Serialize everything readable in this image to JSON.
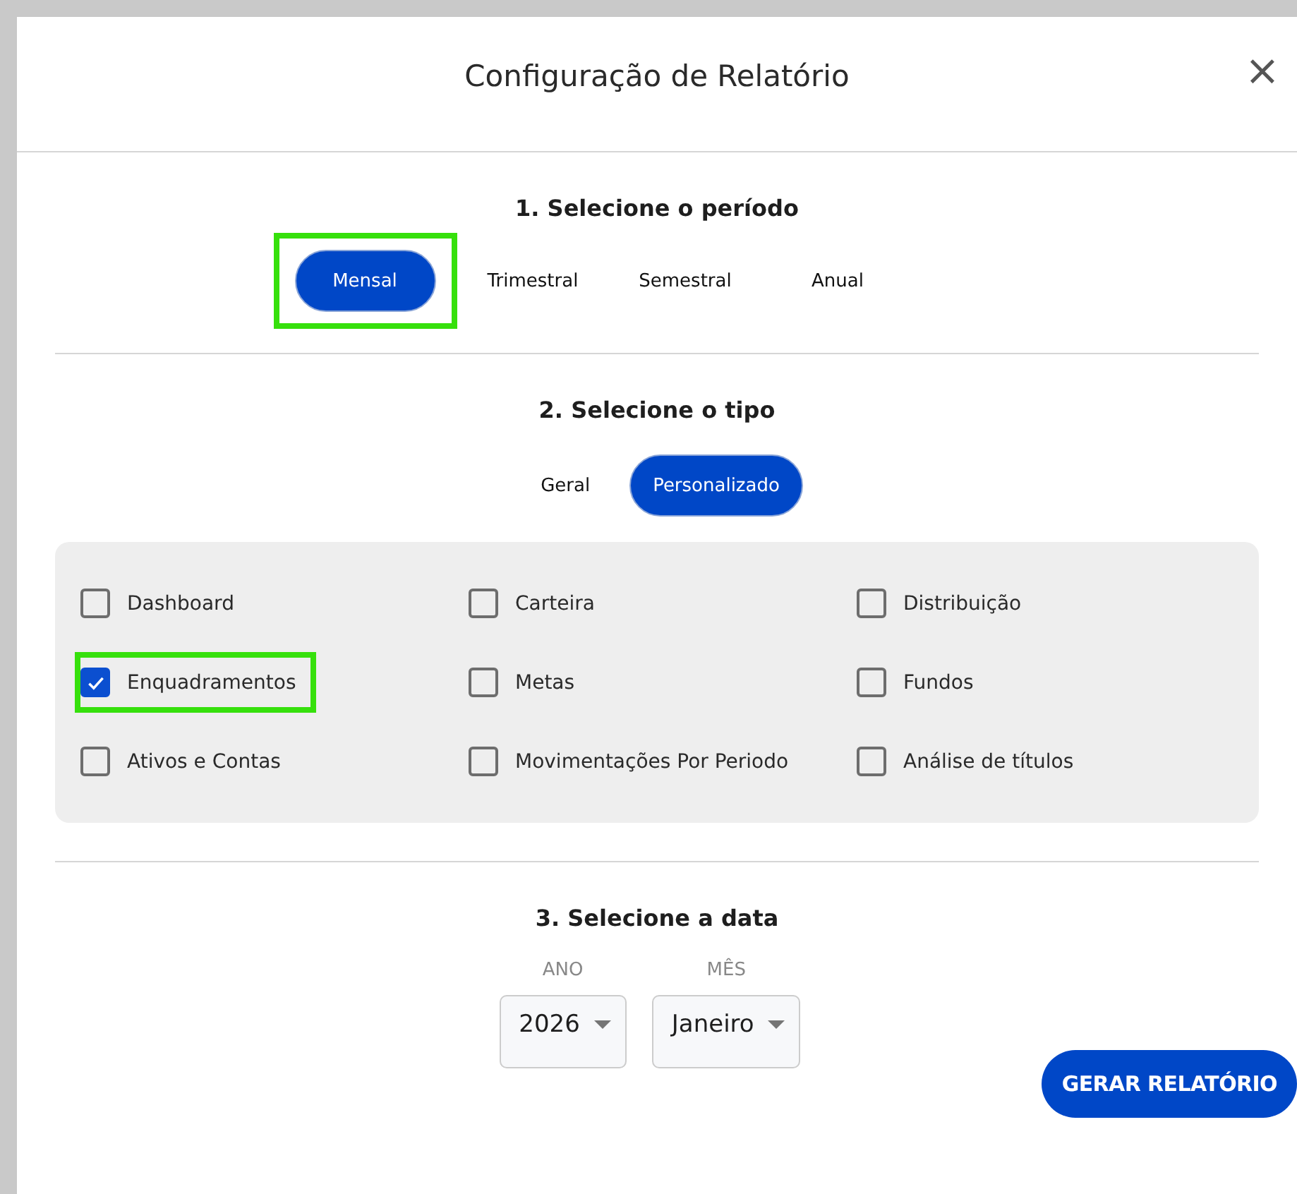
{
  "dialog": {
    "title": "Configuração de Relatório",
    "close": "×"
  },
  "period": {
    "heading": "1. Selecione o período",
    "options": [
      {
        "label": "Mensal",
        "selected": true,
        "highlighted": true
      },
      {
        "label": "Trimestral",
        "selected": false,
        "highlighted": false
      },
      {
        "label": "Semestral",
        "selected": false,
        "highlighted": false
      },
      {
        "label": "Anual",
        "selected": false,
        "highlighted": false
      }
    ]
  },
  "type": {
    "heading": "2. Selecione o tipo",
    "options": [
      {
        "label": "Geral",
        "selected": false
      },
      {
        "label": "Personalizado",
        "selected": true
      }
    ]
  },
  "reports": [
    {
      "label": "Dashboard",
      "checked": false,
      "highlighted": false
    },
    {
      "label": "Carteira",
      "checked": false,
      "highlighted": false
    },
    {
      "label": "Distribuição",
      "checked": false,
      "highlighted": false
    },
    {
      "label": "Enquadramentos",
      "checked": true,
      "highlighted": true
    },
    {
      "label": "Metas",
      "checked": false,
      "highlighted": false
    },
    {
      "label": "Fundos",
      "checked": false,
      "highlighted": false
    },
    {
      "label": "Ativos e Contas",
      "checked": false,
      "highlighted": false
    },
    {
      "label": "Movimentações Por Periodo",
      "checked": false,
      "highlighted": false
    },
    {
      "label": "Análise de títulos",
      "checked": false,
      "highlighted": false
    }
  ],
  "date": {
    "heading": "3. Selecione a data",
    "fields": [
      {
        "label": "ANO",
        "value": "2026"
      },
      {
        "label": "MÊS",
        "value": "Janeiro"
      }
    ]
  },
  "submit": "GERAR RELATÓRIO"
}
